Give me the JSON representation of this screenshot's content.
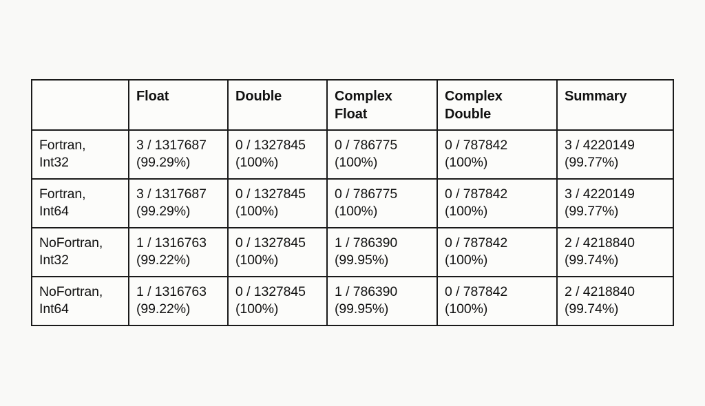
{
  "table": {
    "headers": [
      {
        "line1": "",
        "line2": ""
      },
      {
        "line1": "Float",
        "line2": ""
      },
      {
        "line1": "Double",
        "line2": ""
      },
      {
        "line1": "Complex",
        "line2": "Float"
      },
      {
        "line1": "Complex",
        "line2": "Double"
      },
      {
        "line1": "Summary",
        "line2": ""
      }
    ],
    "rows": [
      {
        "label_line1": "Fortran,",
        "label_line2": "Int32",
        "cells": [
          {
            "counts": "3 / 1317687",
            "percent": "(99.29%)"
          },
          {
            "counts": "0 / 1327845",
            "percent": "(100%)"
          },
          {
            "counts": "0 / 786775",
            "percent": "(100%)"
          },
          {
            "counts": "0 / 787842",
            "percent": "(100%)"
          },
          {
            "counts": "3 / 4220149",
            "percent": "(99.77%)"
          }
        ]
      },
      {
        "label_line1": "Fortran,",
        "label_line2": "Int64",
        "cells": [
          {
            "counts": "3 / 1317687",
            "percent": "(99.29%)"
          },
          {
            "counts": "0 / 1327845",
            "percent": "(100%)"
          },
          {
            "counts": "0 / 786775",
            "percent": "(100%)"
          },
          {
            "counts": "0 / 787842",
            "percent": "(100%)"
          },
          {
            "counts": "3 / 4220149",
            "percent": "(99.77%)"
          }
        ]
      },
      {
        "label_line1": "NoFortran,",
        "label_line2": "Int32",
        "cells": [
          {
            "counts": "1 / 1316763",
            "percent": "(99.22%)"
          },
          {
            "counts": "0 / 1327845",
            "percent": "(100%)"
          },
          {
            "counts": "1 / 786390",
            "percent": "(99.95%)"
          },
          {
            "counts": "0 / 787842",
            "percent": "(100%)"
          },
          {
            "counts": "2 / 4218840",
            "percent": "(99.74%)"
          }
        ]
      },
      {
        "label_line1": "NoFortran,",
        "label_line2": "Int64",
        "cells": [
          {
            "counts": "1 / 1316763",
            "percent": "(99.22%)"
          },
          {
            "counts": "0 / 1327845",
            "percent": "(100%)"
          },
          {
            "counts": "1 / 786390",
            "percent": "(99.95%)"
          },
          {
            "counts": "0 / 787842",
            "percent": "(100%)"
          },
          {
            "counts": "2 / 4218840",
            "percent": "(99.74%)"
          }
        ]
      }
    ]
  },
  "colors": {
    "page_background": "#f9f9f7",
    "table_background": "#fcfcfa",
    "border": "#1a1a1a",
    "text": "#111111"
  }
}
